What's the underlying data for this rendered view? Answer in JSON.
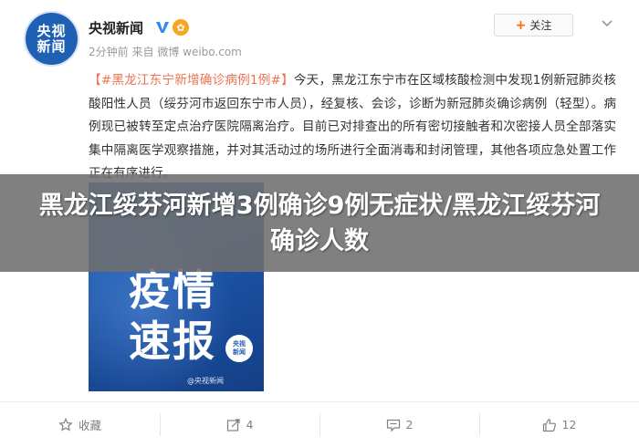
{
  "account": {
    "name": "央视新闻",
    "avatar_text": [
      "央视",
      "新闻"
    ],
    "time": "2分钟前",
    "source_prefix": "来自",
    "source": "微博 weibo.com",
    "vip_mark": "✿"
  },
  "header": {
    "follow_label": "关注",
    "follow_plus": "+"
  },
  "post": {
    "hashtag": "【#黑龙江东宁新增确诊病例1例#】",
    "body": "今天，黑龙江东宁市在区域核酸检测中发现1例新冠肺炎核酸阳性人员（绥芬河市返回东宁市人员），经复核、会诊，诊断为新冠肺炎确诊病例（轻型）。病例现已被转至定点治疗医院隔离治疗。目前已对排查出的所有密切接触者和次密接人员全部落实集中隔离医学观察措施，并对其活动过的场所进行全面消毒和封闭管理，其他各项应急处置工作正在有序进行。"
  },
  "image": {
    "line1": "疫情",
    "line2": "速报",
    "badge": [
      "央视",
      "新闻"
    ],
    "watermark": "@央视新闻"
  },
  "banner": {
    "title": "黑龙江绥芬河新增3例确诊9例无症状/黑龙江绥芬河确诊人数"
  },
  "actions": {
    "collect_label": "收藏",
    "repost_count": "4",
    "comment_count": "2",
    "like_count": "12"
  },
  "colors": {
    "hashtag": "#eb7350",
    "avatar_bg": "#1f5fb4",
    "banner_bg": "#6e6e6e"
  }
}
